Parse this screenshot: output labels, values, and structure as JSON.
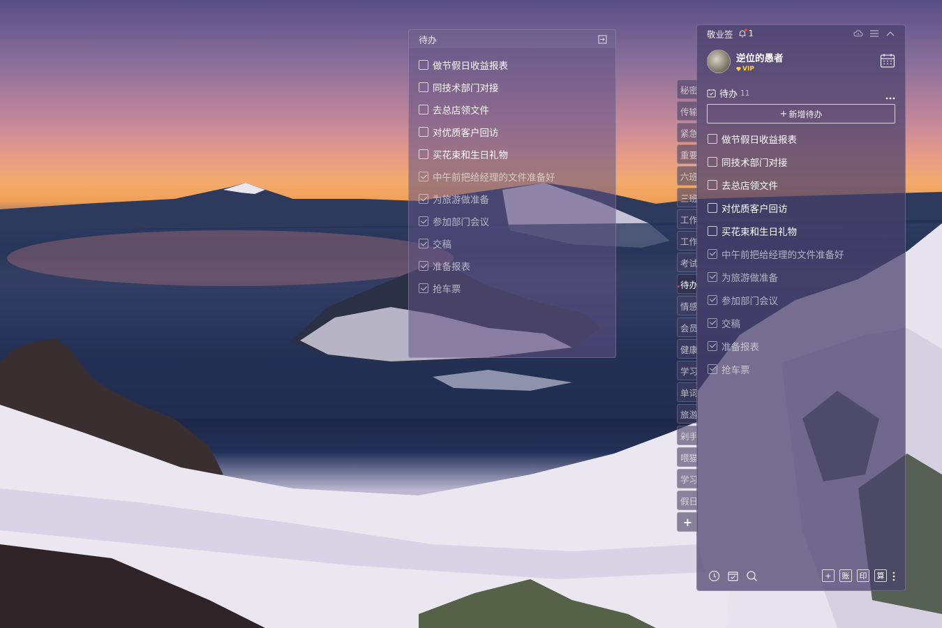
{
  "float_note": {
    "title": "待办",
    "items": [
      {
        "text": "做节假日收益报表",
        "done": false
      },
      {
        "text": "同技术部门对接",
        "done": false
      },
      {
        "text": "去总店领文件",
        "done": false
      },
      {
        "text": "对优质客户回访",
        "done": false
      },
      {
        "text": "买花束和生日礼物",
        "done": false
      },
      {
        "text": "中午前把给经理的文件准备好",
        "done": true
      },
      {
        "text": "为旅游做准备",
        "done": true
      },
      {
        "text": "参加部门会议",
        "done": true
      },
      {
        "text": "交稿",
        "done": true
      },
      {
        "text": "准备报表",
        "done": true
      },
      {
        "text": "抢车票",
        "done": true
      }
    ]
  },
  "side_tabs": [
    {
      "label": "秘密",
      "active": false
    },
    {
      "label": "传输",
      "active": false
    },
    {
      "label": "紧急",
      "active": false
    },
    {
      "label": "重要",
      "active": false
    },
    {
      "label": "六班",
      "active": false
    },
    {
      "label": "三班",
      "active": false
    },
    {
      "label": "工作",
      "active": false
    },
    {
      "label": "工作",
      "active": false
    },
    {
      "label": "考试",
      "active": false
    },
    {
      "label": "待办",
      "active": true
    },
    {
      "label": "情感",
      "active": false
    },
    {
      "label": "会员",
      "active": false
    },
    {
      "label": "健康",
      "active": false
    },
    {
      "label": "学习",
      "active": false
    },
    {
      "label": "单词",
      "active": false
    },
    {
      "label": "旅游",
      "active": false
    },
    {
      "label": "剁手",
      "active": false
    },
    {
      "label": "喂猫",
      "active": false
    },
    {
      "label": "学习",
      "active": false
    },
    {
      "label": "假日",
      "active": false
    }
  ],
  "side_add_label": "+",
  "main_panel": {
    "app_name": "敬业签",
    "notification_count": "1",
    "user": {
      "name": "逆位的愚者",
      "badge": "VIP"
    },
    "section": {
      "title": "待办",
      "count": "11"
    },
    "add_button": {
      "label": "新增待办",
      "plus": "+"
    },
    "items": [
      {
        "text": "做节假日收益报表",
        "done": false
      },
      {
        "text": "同技术部门对接",
        "done": false
      },
      {
        "text": "去总店领文件",
        "done": false
      },
      {
        "text": "对优质客户回访",
        "done": false
      },
      {
        "text": "买花束和生日礼物",
        "done": false
      },
      {
        "text": "中午前把给经理的文件准备好",
        "done": true
      },
      {
        "text": "为旅游做准备",
        "done": true
      },
      {
        "text": "参加部门会议",
        "done": true
      },
      {
        "text": "交稿",
        "done": true
      },
      {
        "text": "准备报表",
        "done": true
      },
      {
        "text": "抢车票",
        "done": true
      }
    ],
    "footer_buttons": [
      {
        "label": "+",
        "name": "add-note-button"
      },
      {
        "label": "账",
        "name": "account-button"
      },
      {
        "label": "印",
        "name": "stamp-button"
      },
      {
        "label": "算",
        "name": "calculator-button"
      }
    ]
  },
  "colors": {
    "notify_red": "#ff3b3b",
    "vip_gold": "#ffd43b"
  }
}
